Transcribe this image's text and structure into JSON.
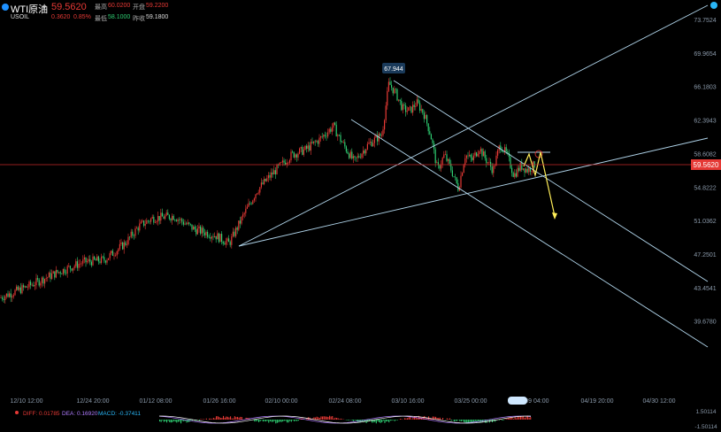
{
  "header": {
    "name": "WTI原油",
    "ticker": "USOIL",
    "price": "59.5620",
    "change": "0.3620",
    "change_pct": "0.85%",
    "high_label": "最高",
    "high": "60.0200",
    "open_label": "开盘",
    "open": "59.2200",
    "low_label": "最低",
    "low": "58.1000",
    "prev_label": "昨收",
    "prev": "59.1800"
  },
  "colors": {
    "up": "#e53935",
    "down": "#2ecc71",
    "lines": "#b0d4ea",
    "arrow": "#ffee58"
  },
  "chart_data": {
    "type": "candlestick",
    "y_ticks": [
      "73.7524",
      "69.9654",
      "66.1803",
      "62.3943",
      "58.6082",
      "54.8222",
      "51.0362",
      "47.2501",
      "43.4541",
      "39.6780"
    ],
    "x_ticks": [
      "12/10 12:00",
      "12/24 20:00",
      "01/12 08:00",
      "01/26 16:00",
      "02/10 00:00",
      "02/24 08:00",
      "03/10 16:00",
      "03/25 00:00",
      "04/09 04:00",
      "04/19 20:00",
      "04/30 12:00"
    ],
    "last_price": "59.5620",
    "peak_label": "67.944",
    "price_path": [
      [
        0,
        46.5
      ],
      [
        0.04,
        47.6
      ],
      [
        0.08,
        48.9
      ],
      [
        0.12,
        50.0
      ],
      [
        0.15,
        50.2
      ],
      [
        0.18,
        51.8
      ],
      [
        0.2,
        53.5
      ],
      [
        0.22,
        54.3
      ],
      [
        0.25,
        54.5
      ],
      [
        0.28,
        53.2
      ],
      [
        0.31,
        52.6
      ],
      [
        0.33,
        51.8
      ],
      [
        0.35,
        54.5
      ],
      [
        0.37,
        57.0
      ],
      [
        0.39,
        58.5
      ],
      [
        0.42,
        60.5
      ],
      [
        0.44,
        61.0
      ],
      [
        0.46,
        62.0
      ],
      [
        0.48,
        63.3
      ],
      [
        0.49,
        62.0
      ],
      [
        0.51,
        59.8
      ],
      [
        0.53,
        61.5
      ],
      [
        0.55,
        62.5
      ],
      [
        0.56,
        67.5
      ],
      [
        0.57,
        66.5
      ],
      [
        0.58,
        65.0
      ],
      [
        0.59,
        64.8
      ],
      [
        0.6,
        65.6
      ],
      [
        0.61,
        64.6
      ],
      [
        0.62,
        62.5
      ],
      [
        0.63,
        59.0
      ],
      [
        0.64,
        60.5
      ],
      [
        0.65,
        59.0
      ],
      [
        0.66,
        57.2
      ],
      [
        0.67,
        60.5
      ],
      [
        0.68,
        60.0
      ],
      [
        0.69,
        61.2
      ],
      [
        0.7,
        60.0
      ],
      [
        0.71,
        59.0
      ],
      [
        0.72,
        61.5
      ],
      [
        0.73,
        60.5
      ],
      [
        0.74,
        58.5
      ],
      [
        0.75,
        59.4
      ],
      [
        0.76,
        59.0
      ],
      [
        0.77,
        59.56
      ]
    ],
    "indicator": {
      "diff_label": "DIFF: 0.01785",
      "dea_label": "DEA: 0.16920",
      "macd_label": "MACD: -0.37411",
      "top_tick": "1.50114",
      "bottom_tick": "-1.50114"
    }
  }
}
